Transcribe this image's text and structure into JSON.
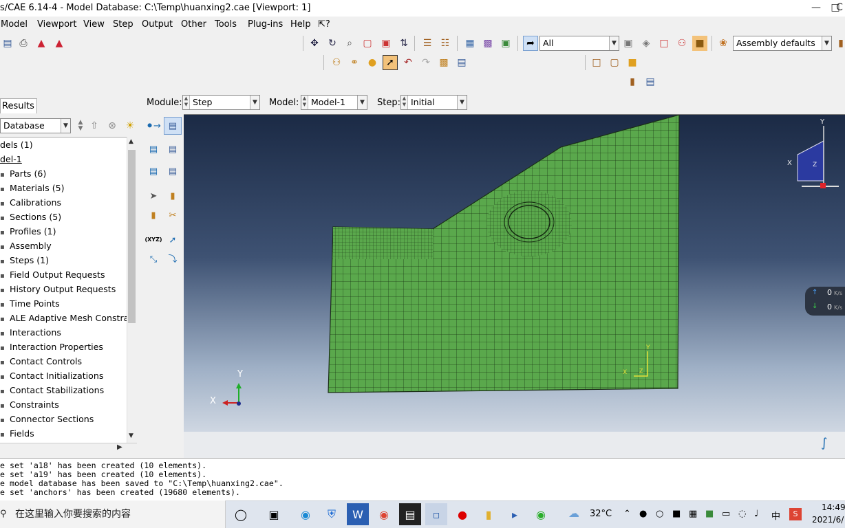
{
  "window": {
    "title": "s/CAE 6.14-4 - Model Database: C:\\Temp\\huanxing2.cae [Viewport: 1]",
    "min_glyph": "—",
    "restore_glyph": "□",
    "close_glyph": "C"
  },
  "menu": [
    "Model",
    "Viewport",
    "View",
    "Step",
    "Output",
    "Other",
    "Tools",
    "Plug-ins",
    "Help",
    "⇱?"
  ],
  "toolbar": {
    "selection_filter": "All",
    "assembly_display": "Assembly defaults"
  },
  "context": {
    "module_label": "Module:",
    "module_value": "Step",
    "model_label": "Model:",
    "model_value": "Model-1",
    "step_label": "Step:",
    "step_value": "Initial"
  },
  "tree_panel": {
    "tab_results": "Results",
    "database_combo": "Database",
    "items": [
      "dels (1)",
      "del-1",
      "Parts (6)",
      "Materials (5)",
      "Calibrations",
      "Sections (5)",
      "Profiles (1)",
      "Assembly",
      "Steps (1)",
      "Field Output Requests",
      "History Output Requests",
      "Time Points",
      "ALE Adaptive Mesh Constrair",
      "Interactions",
      "Interaction Properties",
      "Contact Controls",
      "Contact Initializations",
      "Contact Stabilizations",
      "Constraints",
      "Connector Sections",
      "Fields"
    ]
  },
  "toolbox": {
    "xyz_label": "(XYZ)"
  },
  "viewport": {
    "triad_y": "Y",
    "triad_x": "X",
    "triad_z": "Z",
    "csys_x": "X",
    "csys_y": "Y",
    "csys_z": "Z",
    "view_cube_y": "Y",
    "view_cube_x": "X",
    "view_cube_z": "Z",
    "net_up": "0",
    "net_down": "0",
    "net_unit": "K/s",
    "mesh_color": "#5aa84c"
  },
  "messages": [
    "e set 'a18' has been created (10 elements).",
    "e set 'a19' has been created (10 elements).",
    "e model database has been saved to \"C:\\Temp\\huanxing2.cae\".",
    "e set 'anchors' has been created (19680 elements)."
  ],
  "taskbar": {
    "search_placeholder": "在这里输入你要搜索的内容",
    "weather": "32°C",
    "ime": "中",
    "time": "14:49",
    "date": "2021/6/"
  }
}
